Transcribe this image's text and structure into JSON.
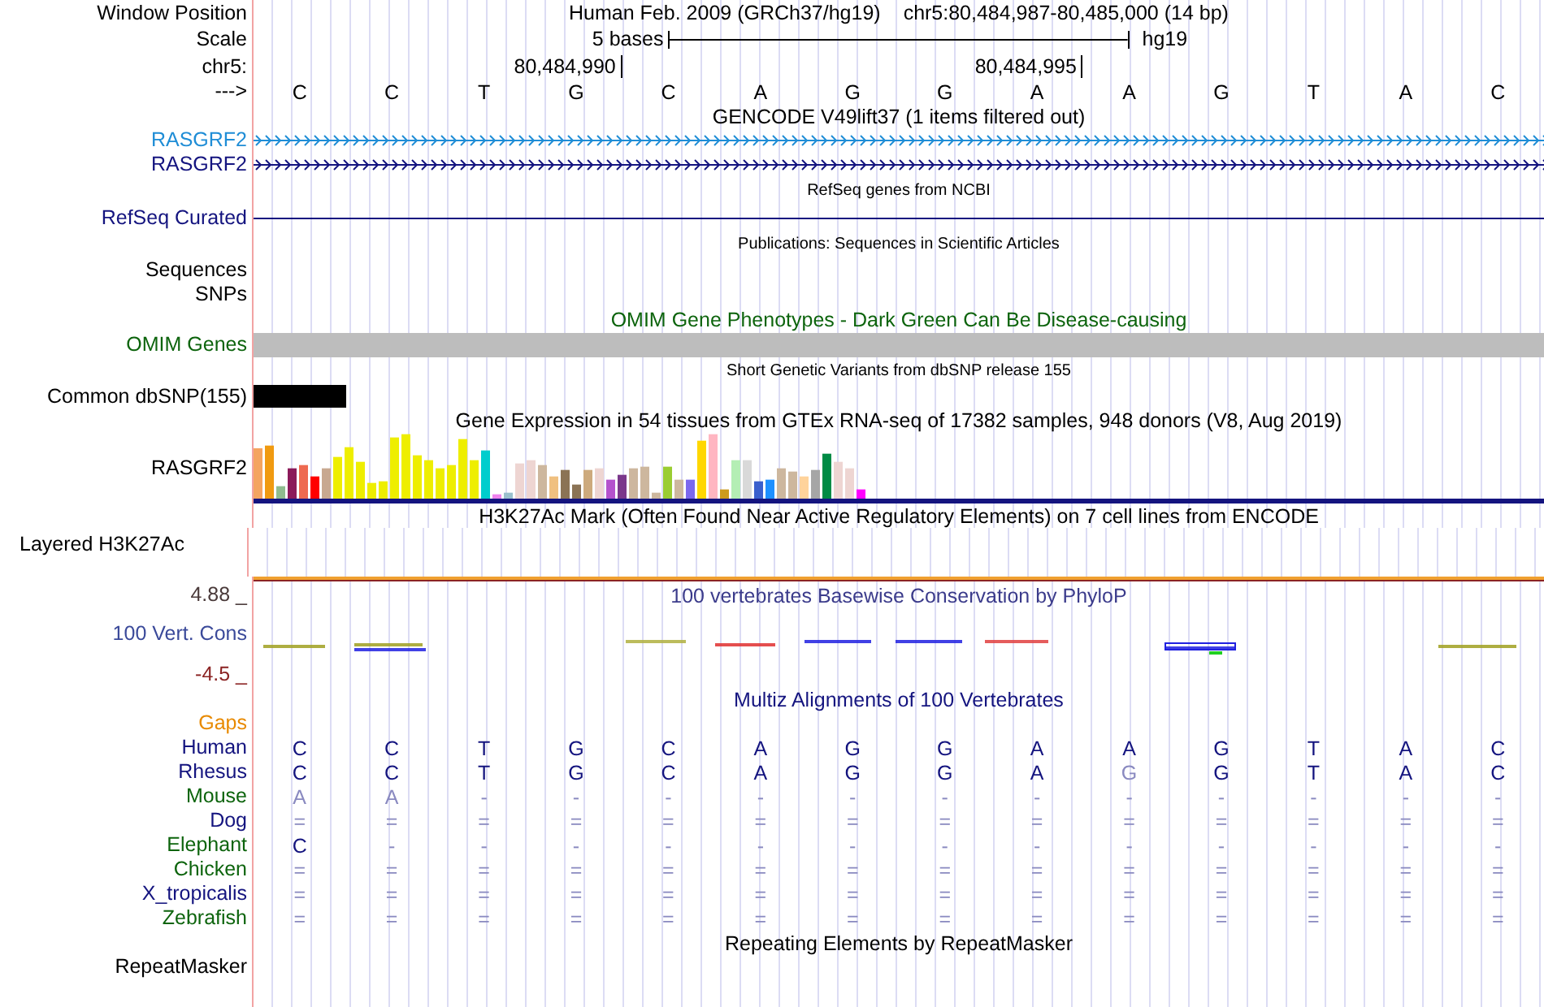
{
  "header": {
    "window_label": "Window Position",
    "assembly": "Human Feb. 2009 (GRCh37/hg19)",
    "position": "chr5:80,484,987-80,485,000 (14 bp)",
    "scale_label": "Scale",
    "scale_text": "5 bases",
    "scale_assembly": "hg19",
    "chrom_label": "chr5:",
    "ticks": [
      "80,484,990",
      "80,484,995"
    ],
    "strand_label": "--->",
    "bases": [
      "C",
      "C",
      "T",
      "G",
      "C",
      "A",
      "G",
      "G",
      "A",
      "A",
      "G",
      "T",
      "A",
      "C"
    ]
  },
  "tracks": [
    {
      "kind": "title",
      "text": "GENCODE V49lift37 (1 items filtered out)"
    },
    {
      "kind": "gene",
      "label": "RASGRF2",
      "color": "#1f8dd6"
    },
    {
      "kind": "gene",
      "label": "RASGRF2",
      "color": "#14147f"
    },
    {
      "kind": "caption",
      "text": "RefSeq genes from NCBI"
    },
    {
      "kind": "line",
      "label": "RefSeq Curated",
      "color": "#14147f"
    },
    {
      "kind": "caption",
      "text": "Publications: Sequences in Scientific Articles"
    },
    {
      "kind": "label",
      "label": "Sequences"
    },
    {
      "kind": "label",
      "label": "SNPs"
    },
    {
      "kind": "title",
      "text": "OMIM Gene Phenotypes - Dark Green Can Be Disease-causing",
      "color": "#0d640d"
    },
    {
      "kind": "bar",
      "label": "OMIM Genes",
      "color": "#0d640d"
    },
    {
      "kind": "caption",
      "text": "Short Genetic Variants from dbSNP release 155"
    },
    {
      "kind": "snp",
      "label": "Common dbSNP(155)"
    },
    {
      "kind": "title",
      "text": "Gene Expression in 54 tissues from GTEx RNA-seq of 17382 samples, 948 donors (V8, Aug 2019)"
    },
    {
      "kind": "expression",
      "label": "RASGRF2"
    },
    {
      "kind": "title",
      "text": "H3K27Ac Mark (Often Found Near Active Regulatory Elements) on 7 cell lines from ENCODE"
    },
    {
      "kind": "layered",
      "label": "Layered H3K27Ac"
    },
    {
      "kind": "conservation",
      "title": "100 vertebrates Basewise Conservation by PhyloP",
      "label": "100 Vert. Cons",
      "max": "4.88 _",
      "min": "-4.5 _"
    },
    {
      "kind": "title",
      "text": "Multiz Alignments of 100 Vertebrates",
      "color": "#14147f"
    },
    {
      "kind": "label",
      "label": "Gaps",
      "color": "#e88a00"
    },
    {
      "kind": "alignment",
      "label": "Human",
      "color": "#14147f",
      "bases": [
        "C",
        "C",
        "T",
        "G",
        "C",
        "A",
        "G",
        "G",
        "A",
        "A",
        "G",
        "T",
        "A",
        "C"
      ],
      "dimmed": [
        false,
        false,
        false,
        false,
        false,
        false,
        false,
        false,
        false,
        false,
        false,
        false,
        false,
        false
      ]
    },
    {
      "kind": "alignment",
      "label": "Rhesus",
      "color": "#14147f",
      "bases": [
        "C",
        "C",
        "T",
        "G",
        "C",
        "A",
        "G",
        "G",
        "A",
        "G",
        "G",
        "T",
        "A",
        "C"
      ],
      "dimmed": [
        false,
        false,
        false,
        false,
        false,
        false,
        false,
        false,
        false,
        true,
        false,
        false,
        false,
        false
      ]
    },
    {
      "kind": "alignment",
      "label": "Mouse",
      "color": "#0d640d",
      "bases": [
        "A",
        "A",
        "-",
        "-",
        "-",
        "-",
        "-",
        "-",
        "-",
        "-",
        "-",
        "-",
        "-",
        "-"
      ],
      "dimmed": [
        true,
        true,
        true,
        true,
        true,
        true,
        true,
        true,
        true,
        true,
        true,
        true,
        true,
        true
      ]
    },
    {
      "kind": "alignment",
      "label": "Dog",
      "color": "#14147f",
      "bases": [
        "=",
        "=",
        "=",
        "=",
        "=",
        "=",
        "=",
        "=",
        "=",
        "=",
        "=",
        "=",
        "=",
        "="
      ],
      "dimmed": [
        true,
        true,
        true,
        true,
        true,
        true,
        true,
        true,
        true,
        true,
        true,
        true,
        true,
        true
      ]
    },
    {
      "kind": "alignment",
      "label": "Elephant",
      "color": "#0d640d",
      "bases": [
        "C",
        "-",
        "-",
        "-",
        "-",
        "-",
        "-",
        "-",
        "-",
        "-",
        "-",
        "-",
        "-",
        "-"
      ],
      "dimmed": [
        false,
        true,
        true,
        true,
        true,
        true,
        true,
        true,
        true,
        true,
        true,
        true,
        true,
        true
      ]
    },
    {
      "kind": "alignment",
      "label": "Chicken",
      "color": "#0d640d",
      "bases": [
        "=",
        "=",
        "=",
        "=",
        "=",
        "=",
        "=",
        "=",
        "=",
        "=",
        "=",
        "=",
        "=",
        "="
      ],
      "dimmed": [
        true,
        true,
        true,
        true,
        true,
        true,
        true,
        true,
        true,
        true,
        true,
        true,
        true,
        true
      ]
    },
    {
      "kind": "alignment",
      "label": "X_tropicalis",
      "color": "#14147f",
      "bases": [
        "=",
        "=",
        "=",
        "=",
        "=",
        "=",
        "=",
        "=",
        "=",
        "=",
        "=",
        "=",
        "=",
        "="
      ],
      "dimmed": [
        true,
        true,
        true,
        true,
        true,
        true,
        true,
        true,
        true,
        true,
        true,
        true,
        true,
        true
      ]
    },
    {
      "kind": "alignment",
      "label": "Zebrafish",
      "color": "#0d640d",
      "bases": [
        "=",
        "=",
        "=",
        "=",
        "=",
        "=",
        "=",
        "=",
        "=",
        "=",
        "=",
        "=",
        "=",
        "="
      ],
      "dimmed": [
        true,
        true,
        true,
        true,
        true,
        true,
        true,
        true,
        true,
        true,
        true,
        true,
        true,
        true
      ]
    },
    {
      "kind": "title",
      "text": "Repeating Elements by RepeatMasker"
    },
    {
      "kind": "label",
      "label": "RepeatMasker"
    }
  ]
}
